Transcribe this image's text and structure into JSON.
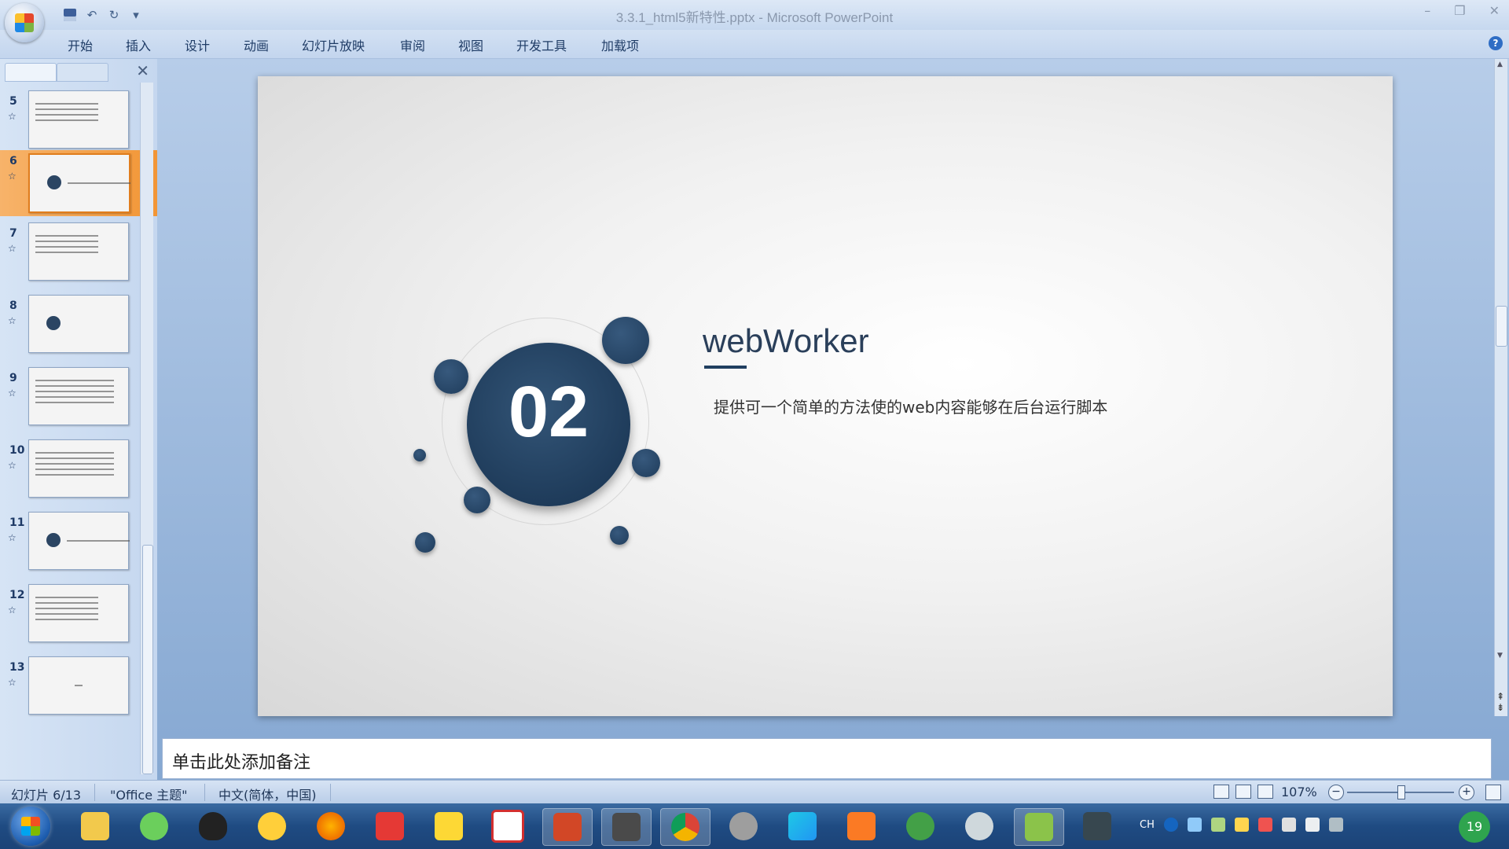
{
  "window": {
    "title": "3.3.1_html5新特性.pptx - Microsoft PowerPoint"
  },
  "ribbon": {
    "tabs": [
      "开始",
      "插入",
      "设计",
      "动画",
      "幻灯片放映",
      "审阅",
      "视图",
      "开发工具",
      "加载项"
    ]
  },
  "thumbnails": [
    {
      "num": "5"
    },
    {
      "num": "6",
      "selected": true
    },
    {
      "num": "7"
    },
    {
      "num": "8"
    },
    {
      "num": "9"
    },
    {
      "num": "10"
    },
    {
      "num": "11"
    },
    {
      "num": "12"
    },
    {
      "num": "13"
    }
  ],
  "slide": {
    "number_badge": "02",
    "title": "webWorker",
    "body": "提供可一个简单的方法使的web内容能够在后台运行脚本",
    "accent_color": "#1f3c5b"
  },
  "notes": {
    "placeholder": "单击此处添加备注"
  },
  "status": {
    "slide_position": "幻灯片 6/13",
    "theme": "\"Office 主题\"",
    "language": "中文(简体，中国)",
    "zoom": "107%"
  },
  "taskbar": {
    "apps": [
      "file-explorer",
      "wechat",
      "qq",
      "messenger",
      "firefox",
      "xmind",
      "app-red",
      "app-yellow",
      "powerpoint",
      "sublime",
      "chrome",
      "raccoon",
      "webstorm",
      "xampp",
      "leaf",
      "magnifier",
      "notepad",
      "camera"
    ],
    "tray_lang": "CH",
    "clock": "19"
  }
}
